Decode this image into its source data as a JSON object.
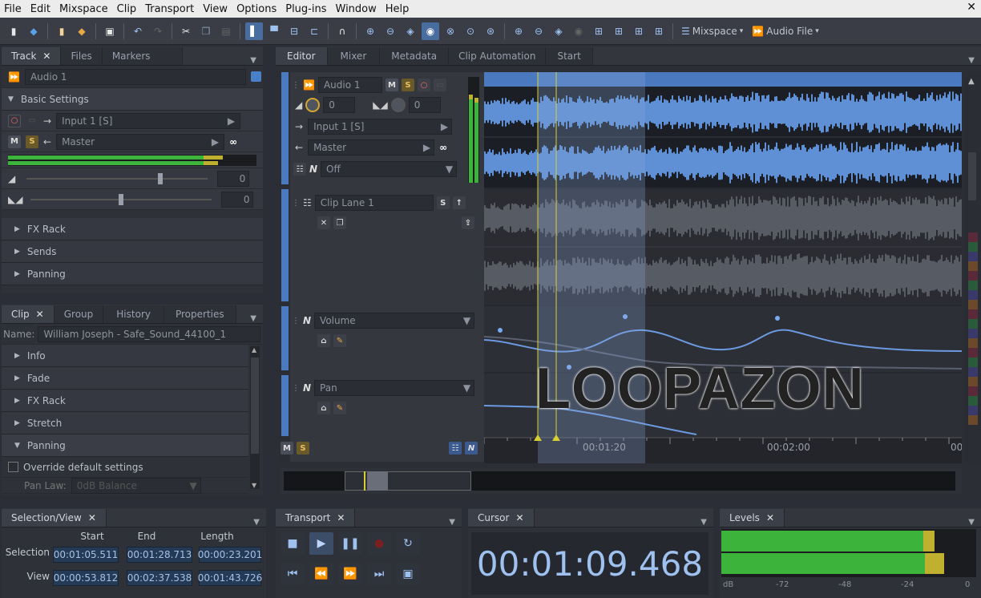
{
  "menu": [
    "File",
    "Edit",
    "Mixspace",
    "Clip",
    "Transport",
    "View",
    "Options",
    "Plug-ins",
    "Window",
    "Help"
  ],
  "toolbar": {
    "mixspace_label": "Mixspace",
    "audio_file_label": "Audio File"
  },
  "track_panel": {
    "tabs": [
      "Track",
      "Files",
      "Markers"
    ],
    "track_name": "Audio 1",
    "basic_settings": "Basic Settings",
    "input": "Input 1 [S]",
    "output": "Master",
    "vol_value": "0",
    "pan_value": "0",
    "sections": [
      "FX Rack",
      "Sends",
      "Panning"
    ]
  },
  "clip_panel": {
    "tabs": [
      "Clip",
      "Group",
      "History",
      "Properties"
    ],
    "name_label": "Name:",
    "name_value": "William Joseph - Safe_Sound_44100_1",
    "sections": [
      "Info",
      "Fade",
      "FX Rack",
      "Stretch",
      "Panning"
    ],
    "override": "Override default settings",
    "pan_law_label": "Pan Law:",
    "pan_law_value": "0dB Balance"
  },
  "editor": {
    "tabs": [
      "Editor",
      "Mixer",
      "Metadata",
      "Clip Automation",
      "Start"
    ],
    "track_name": "Audio 1",
    "vol": "0",
    "pan": "0",
    "input": "Input 1 [S]",
    "output": "Master",
    "automation": "Off",
    "clip_lane": "Clip Lane 1",
    "lane_volume": "Volume",
    "lane_pan": "Pan",
    "watermark": "LOOPAZON",
    "ruler": [
      "00:01:20",
      "00:02:00",
      "00"
    ]
  },
  "selection_panel": {
    "tab": "Selection/View",
    "headers": [
      "Start",
      "End",
      "Length"
    ],
    "rows": [
      {
        "label": "Selection",
        "start": "00:01:05.511",
        "end": "00:01:28.713",
        "length": "00:00:23.201"
      },
      {
        "label": "View",
        "start": "00:00:53.812",
        "end": "00:02:37.538",
        "length": "00:01:43.726"
      }
    ]
  },
  "transport_panel": {
    "tab": "Transport"
  },
  "cursor_panel": {
    "tab": "Cursor",
    "time": "00:01:09.468"
  },
  "levels_panel": {
    "tab": "Levels",
    "scale": [
      "dB",
      "-72",
      "-48",
      "-24",
      "0"
    ]
  }
}
